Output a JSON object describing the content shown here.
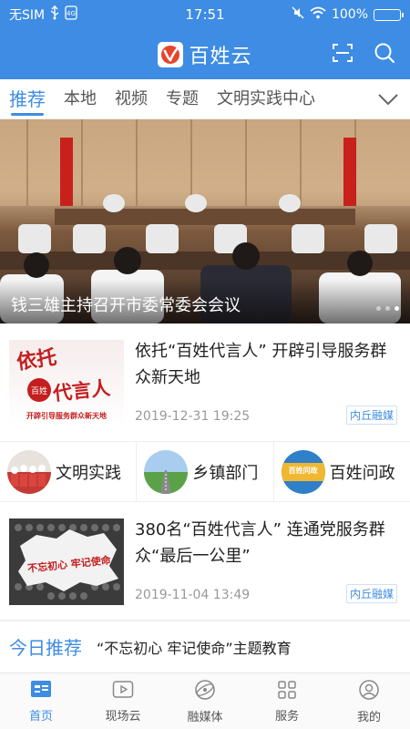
{
  "status_bar": {
    "carrier": "无SIM",
    "time": "17:51",
    "battery": "100%"
  },
  "app": {
    "title": "百姓云"
  },
  "tabs": [
    {
      "label": "推荐",
      "active": true
    },
    {
      "label": "本地"
    },
    {
      "label": "视频"
    },
    {
      "label": "专题"
    },
    {
      "label": "文明实践中心"
    }
  ],
  "hero": {
    "caption": "钱三雄主持召开市委常委会会议",
    "slide_index": 3,
    "slide_count": 3
  },
  "news": [
    {
      "title": "依托“百姓代言人” 开辟引导服务群众新天地",
      "thumb_text_1": "依托",
      "thumb_text_2": "代言人",
      "thumb_badge": "百姓",
      "thumb_caption": "开辟引导服务群众新天地",
      "date": "2019-12-31 19:25",
      "source": "内丘融媒"
    },
    {
      "title": "380名“百姓代言人” 连通党服务群众“最后一公里”",
      "thumb_caption": "不忘初心 牢记使命",
      "date": "2019-11-04 13:49",
      "source": "内丘融媒"
    }
  ],
  "quick_entries": [
    {
      "label": "文明实践"
    },
    {
      "label": "乡镇部门"
    },
    {
      "label": "百姓问政",
      "icon_text": "百姓问政"
    }
  ],
  "today": {
    "label": "今日推荐",
    "text": "“不忘初心 牢记使命”主题教育"
  },
  "bottom_nav": [
    {
      "label": "首页",
      "active": true
    },
    {
      "label": "现场云"
    },
    {
      "label": "融媒体"
    },
    {
      "label": "服务"
    },
    {
      "label": "我的"
    }
  ],
  "colors": {
    "brand": "#3e8ce3",
    "logo_red": "#e4462c"
  }
}
